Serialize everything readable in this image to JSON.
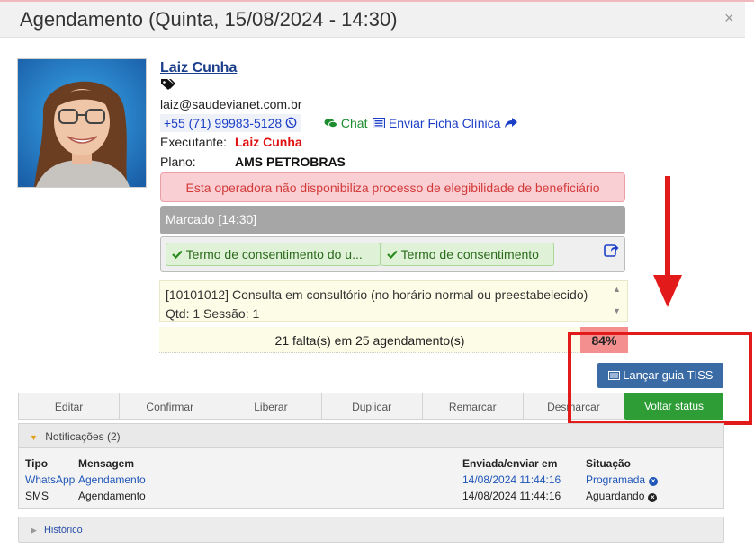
{
  "modal": {
    "title": "Agendamento (Quinta, 15/08/2024 - 14:30)",
    "close_glyph": "×"
  },
  "patient": {
    "name": "Laiz Cunha",
    "email": "laiz@saudevianet.com.br",
    "phone": "+55 (71) 99983-5128",
    "chat_label": "Chat",
    "ficha_label": "Enviar Ficha Clínica",
    "executante_label": "Executante:",
    "executante_value": "Laiz Cunha",
    "plano_label": "Plano:",
    "plano_value": "AMS PETROBRAS"
  },
  "alert": {
    "text": "Esta operadora não disponibiliza processo de elegibilidade de beneficiário"
  },
  "status": {
    "text": "Marcado [14:30]"
  },
  "terms": [
    {
      "label": "Termo de consentimento do u..."
    },
    {
      "label": "Termo de consentimento"
    }
  ],
  "procedure": {
    "text": "[10101012] Consulta em consultório (no horário normal ou preestabelecido) Qtd: 1 Sessão: 1"
  },
  "attendance": {
    "text": "21 falta(s) em 25 agendamento(s)",
    "percent": "84%"
  },
  "actions": {
    "lancar_guia": "Lançar guia TISS",
    "voltar_status": "Voltar status"
  },
  "toolbar": [
    {
      "label": "Editar"
    },
    {
      "label": "Confirmar"
    },
    {
      "label": "Liberar"
    },
    {
      "label": "Duplicar"
    },
    {
      "label": "Remarcar"
    },
    {
      "label": "Desmarcar"
    }
  ],
  "notifications": {
    "header": "Notificações (2)",
    "columns": {
      "tipo": "Tipo",
      "mensagem": "Mensagem",
      "enviada": "Enviada/enviar em",
      "situacao": "Situação"
    },
    "rows": [
      {
        "tipo": "WhatsApp",
        "mensagem": "Agendamento",
        "enviada": "14/08/2024 11:44:16",
        "situacao": "Programada"
      },
      {
        "tipo": "SMS",
        "mensagem": "Agendamento",
        "enviada": "14/08/2024 11:44:16",
        "situacao": "Aguardando"
      }
    ]
  },
  "history": {
    "label": "Histórico"
  },
  "colors": {
    "link_blue": "#1c3fc7",
    "alert_bg": "#f9cfd3",
    "status_gray": "#a6a6a6",
    "tiss_blue": "#3a6ba5",
    "voltar_green": "#2e9d36",
    "annotation_red": "#e21a1a"
  },
  "icons": [
    "tags-icon",
    "whatsapp-icon",
    "chat-icon",
    "list-icon",
    "share-icon",
    "check-icon",
    "external-link-icon",
    "close-icon",
    "caret-down-icon",
    "caret-right-icon",
    "x-circle-icon",
    "arrow-down-icon"
  ]
}
